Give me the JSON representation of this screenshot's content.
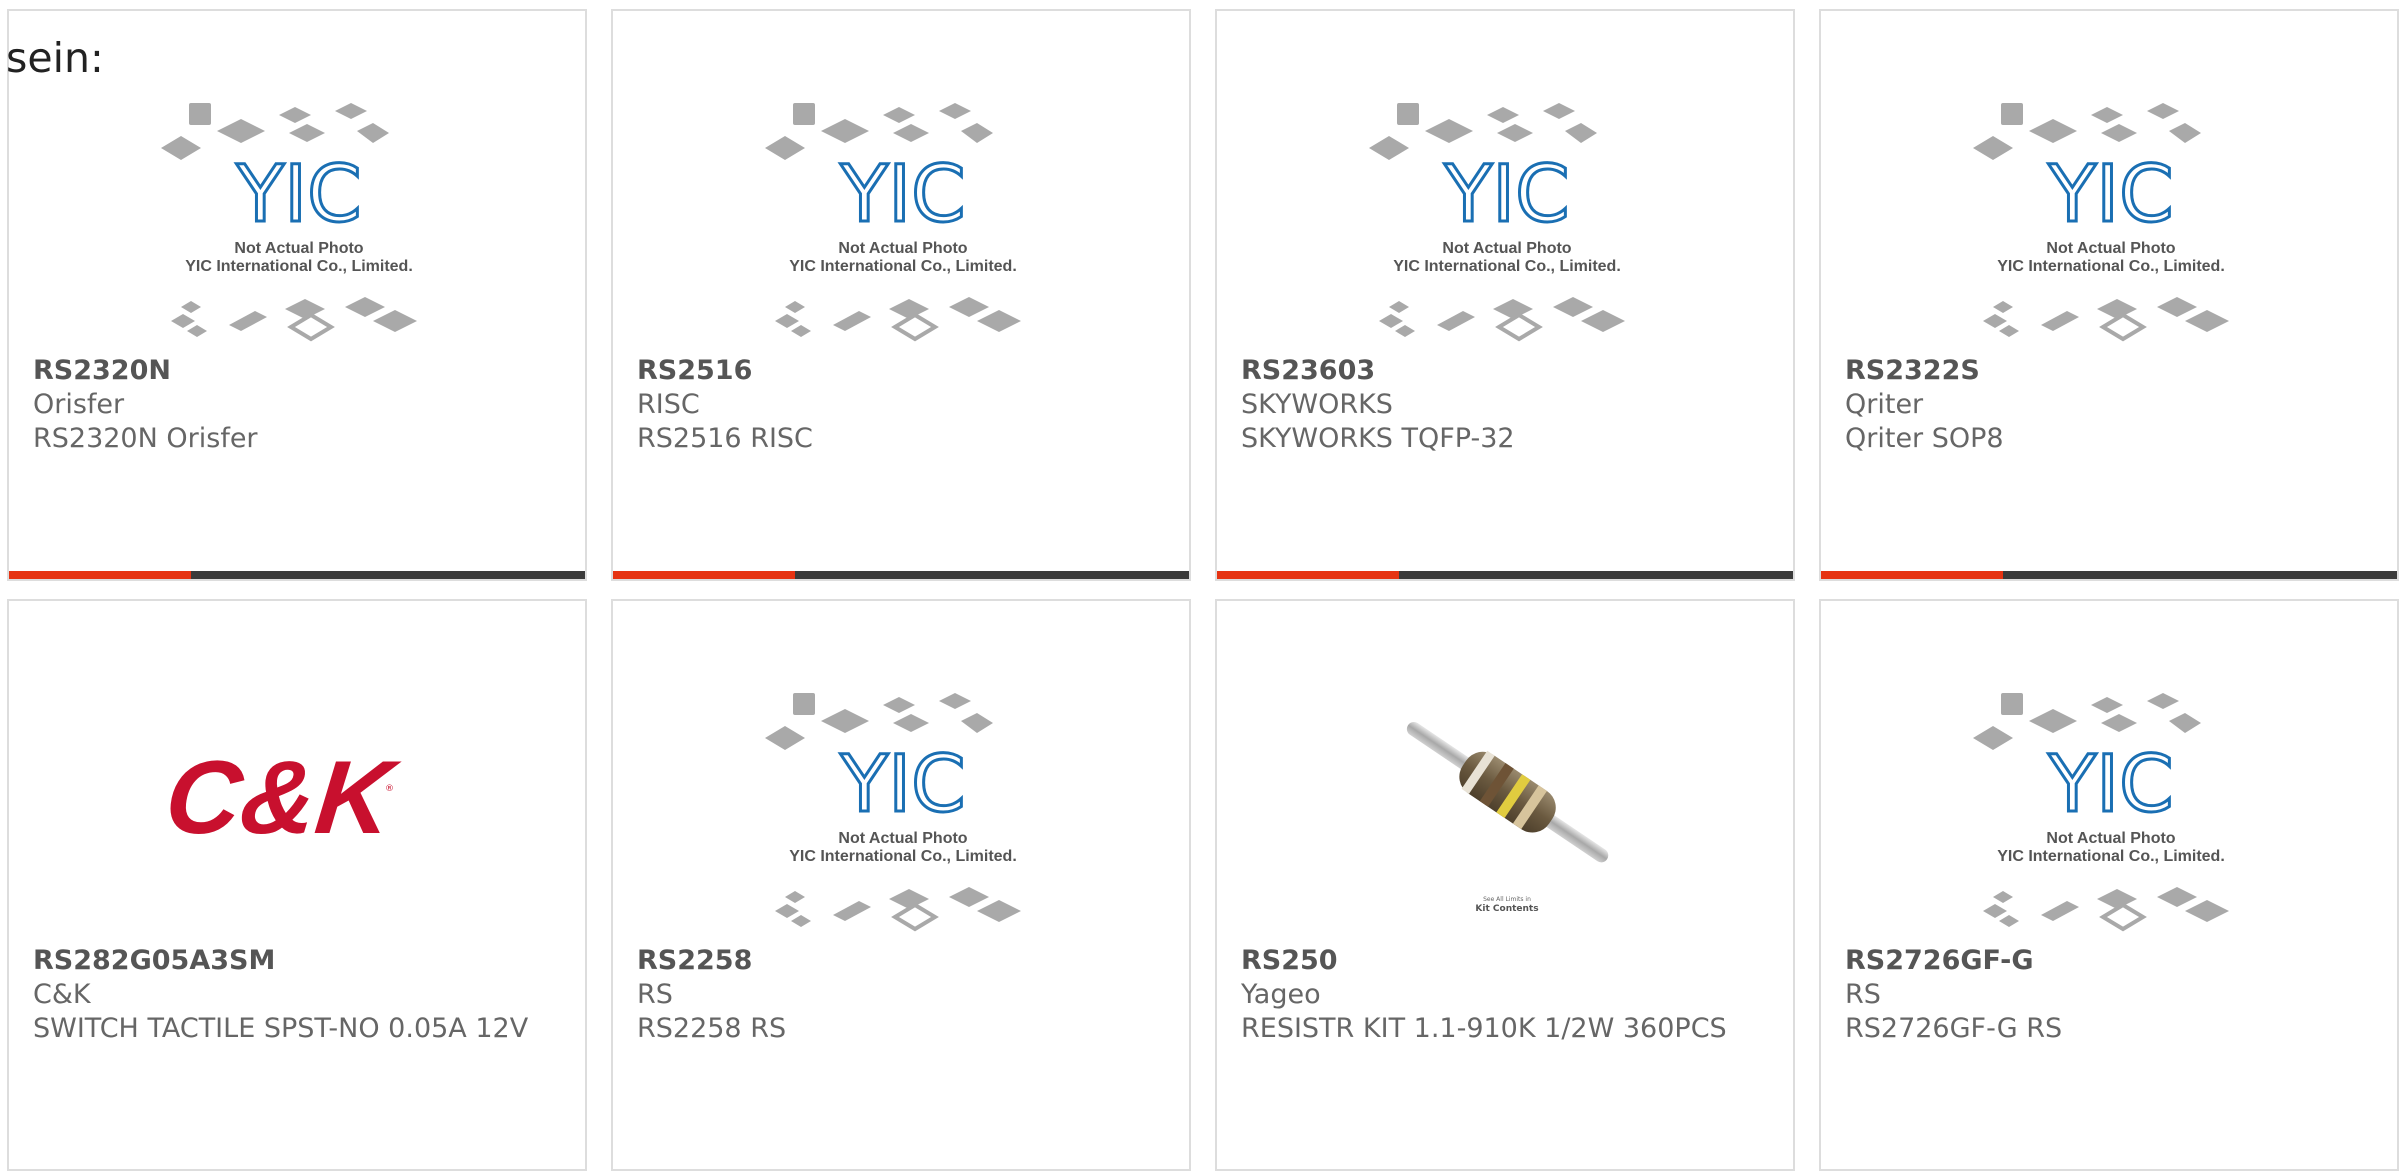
{
  "lead_text": "sein:",
  "placeholder": {
    "logo": "YIC",
    "line1": "Not Actual Photo",
    "line2": "YIC International Co., Limited."
  },
  "brand_logo": {
    "text": "C&K"
  },
  "kit_label": {
    "line1": "See All Limits in",
    "line2": "Kit Contents"
  },
  "colors": {
    "accent": "#e63312",
    "bar": "#3a3a3a",
    "card_border": "#dddddd",
    "ck_red": "#c8102e"
  },
  "products": [
    {
      "part_number": "RS2320N",
      "manufacturer": "Orisfer",
      "description": "RS2320N Orisfer",
      "image": "yic-placeholder",
      "accent_bar": true
    },
    {
      "part_number": "RS2516",
      "manufacturer": "RISC",
      "description": "RS2516 RISC",
      "image": "yic-placeholder",
      "accent_bar": true
    },
    {
      "part_number": "RS23603",
      "manufacturer": "SKYWORKS",
      "description": "SKYWORKS TQFP-32",
      "image": "yic-placeholder",
      "accent_bar": true
    },
    {
      "part_number": "RS2322S",
      "manufacturer": "Qriter",
      "description": "Qriter SOP8",
      "image": "yic-placeholder",
      "accent_bar": true
    },
    {
      "part_number": "RS282G05A3SM",
      "manufacturer": "C&K",
      "description": "SWITCH TACTILE SPST-NO 0.05A 12V",
      "image": "ck-logo",
      "accent_bar": false
    },
    {
      "part_number": "RS2258",
      "manufacturer": "RS",
      "description": "RS2258 RS",
      "image": "yic-placeholder",
      "accent_bar": false
    },
    {
      "part_number": "RS250",
      "manufacturer": "Yageo",
      "description": "RESISTR KIT 1.1-910K 1/2W 360PCS",
      "image": "resistor-photo",
      "accent_bar": false
    },
    {
      "part_number": "RS2726GF-G",
      "manufacturer": "RS",
      "description": "RS2726GF-G RS",
      "image": "yic-placeholder",
      "accent_bar": false
    }
  ]
}
